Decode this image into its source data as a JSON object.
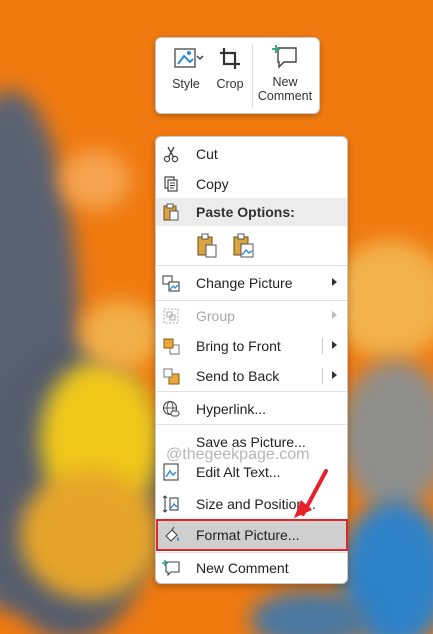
{
  "mini_toolbar": {
    "style_label": "Style",
    "crop_label": "Crop",
    "new_comment_line1": "New",
    "new_comment_line2": "Comment"
  },
  "context_menu": {
    "cut": "Cut",
    "copy": "Copy",
    "paste_options": "Paste Options:",
    "change_picture": "Change Picture",
    "group": "Group",
    "bring_to_front": "Bring to Front",
    "send_to_back": "Send to Back",
    "hyperlink": "Hyperlink...",
    "save_as_picture": "Save as Picture...",
    "edit_alt_text": "Edit Alt Text...",
    "size_and_position": "Size and Position...",
    "format_picture": "Format Picture...",
    "new_comment": "New Comment"
  },
  "watermark": "@thegeekpage.com",
  "colors": {
    "highlight_border": "#e0242c",
    "background_orange": "#f07a10",
    "arrow_red": "#e8202a"
  }
}
